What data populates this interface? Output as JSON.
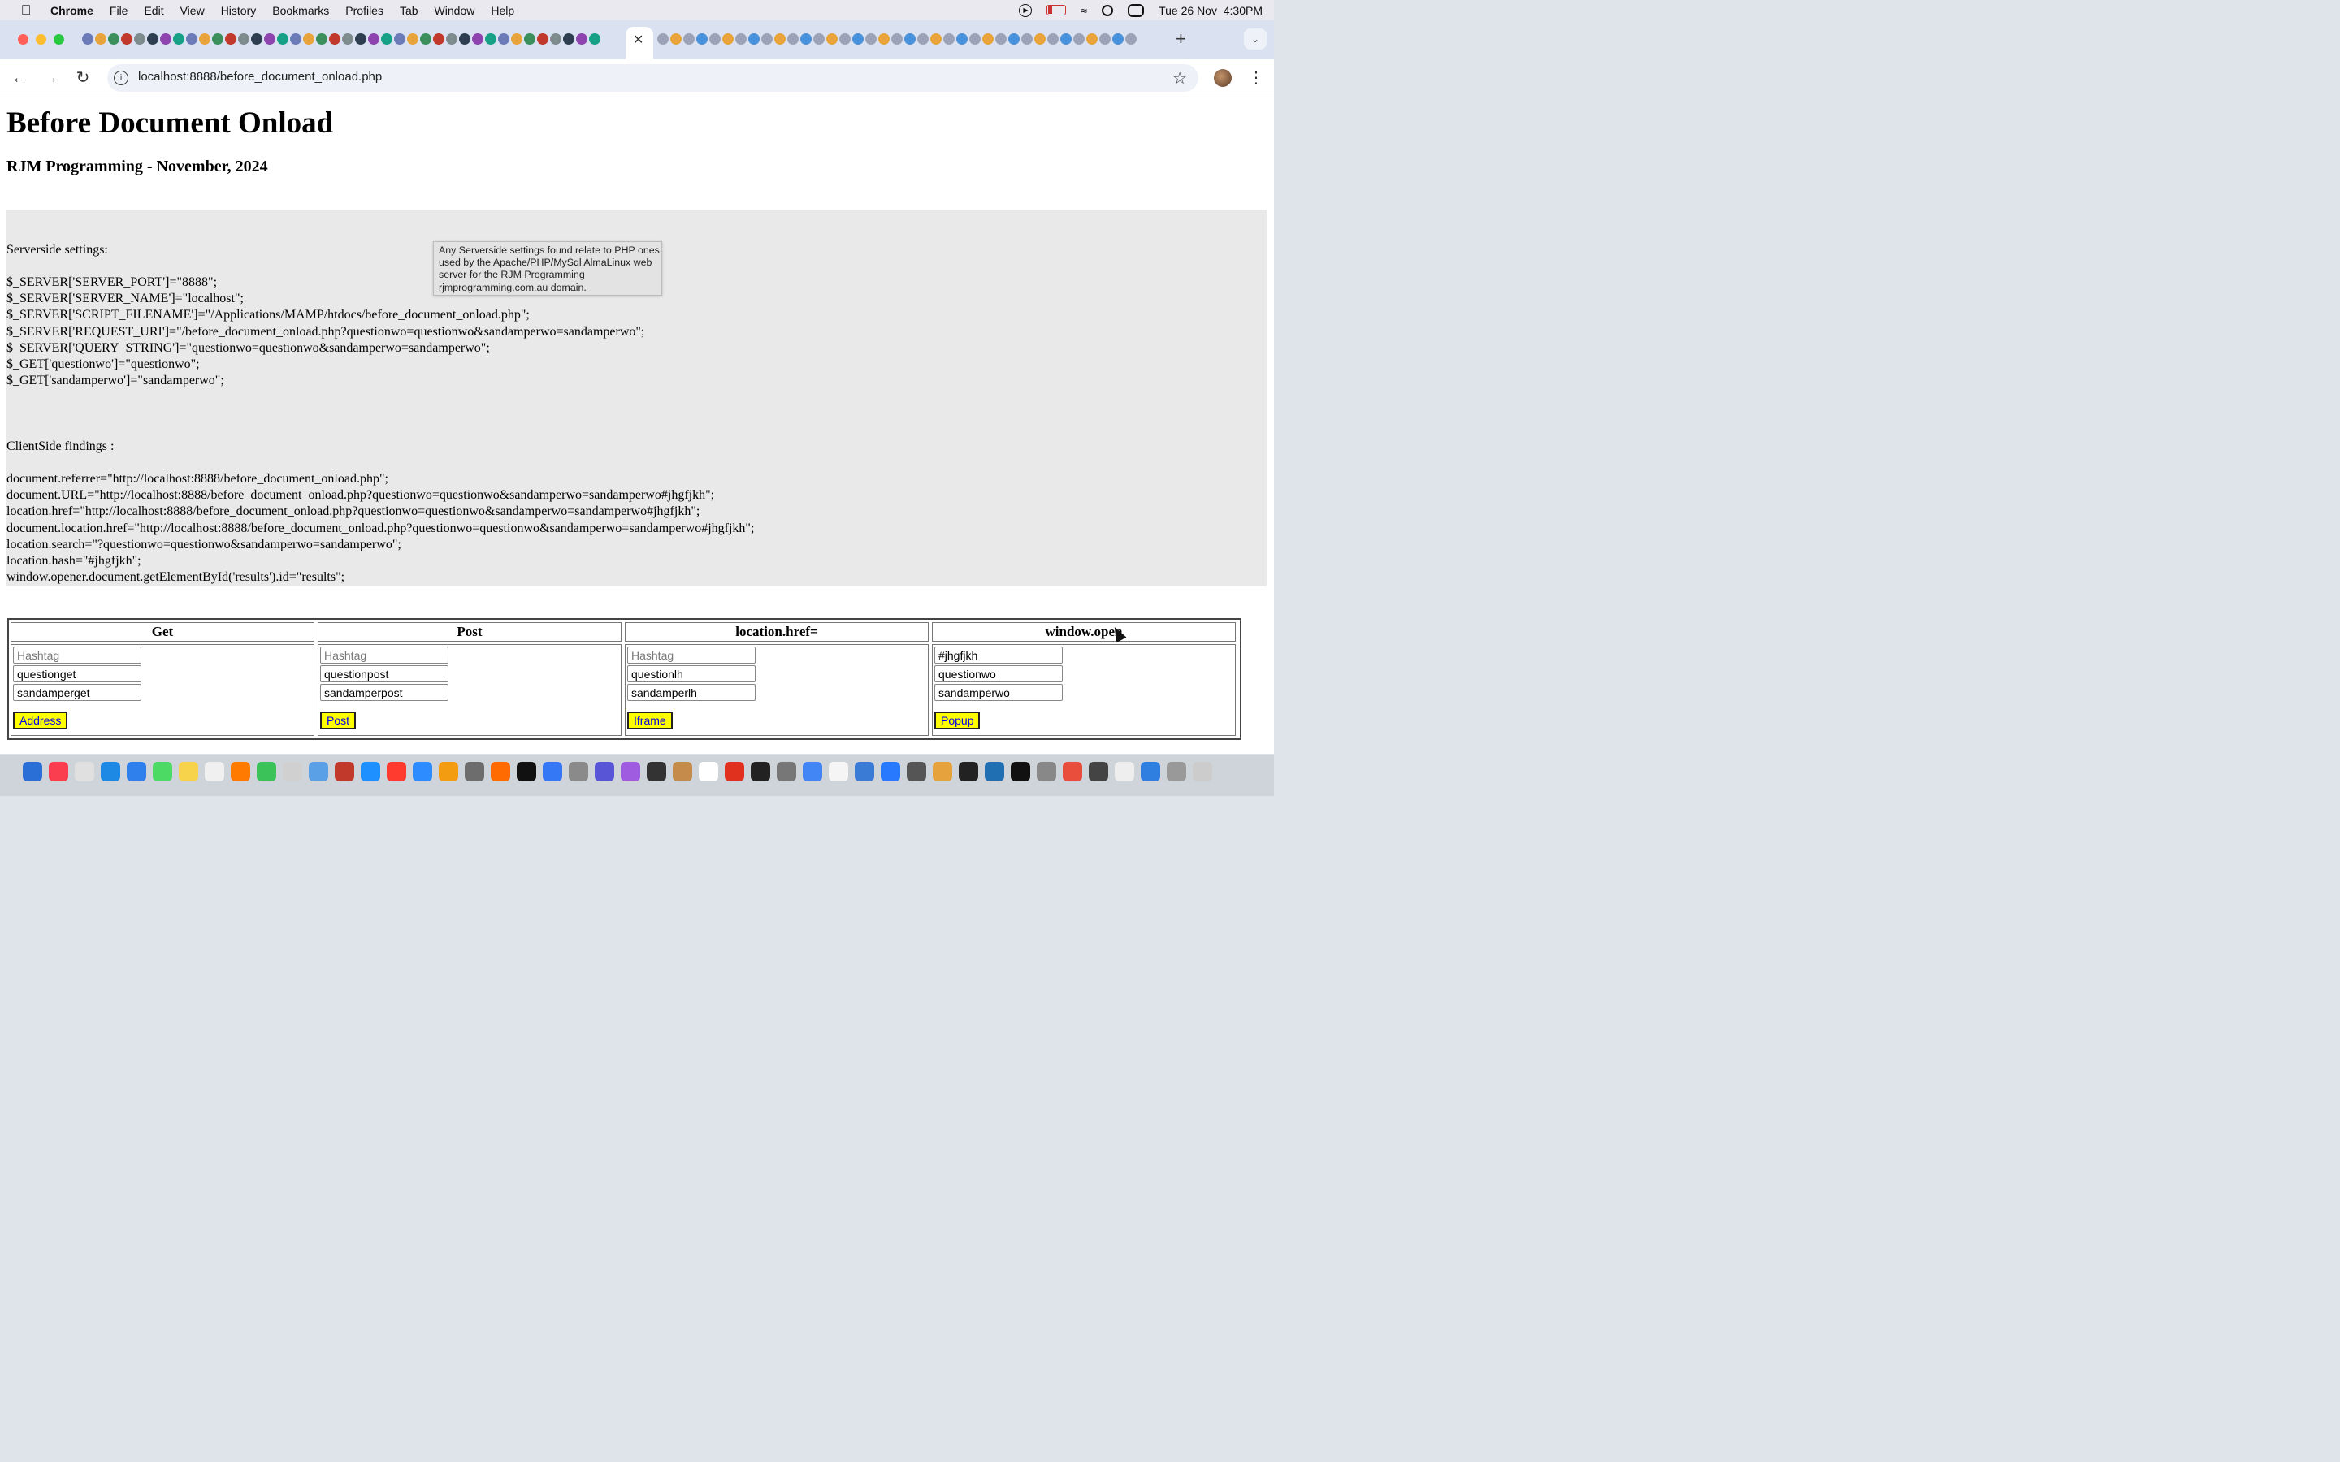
{
  "menubar": {
    "app": "Chrome",
    "items": [
      "File",
      "Edit",
      "View",
      "History",
      "Bookmarks",
      "Profiles",
      "Tab",
      "Window",
      "Help"
    ],
    "datetime": "Tue 26 Nov  4:30PM"
  },
  "toolbar": {
    "url": "localhost:8888/before_document_onload.php"
  },
  "page": {
    "title": "Before Document Onload",
    "subtitle": "RJM Programming - November, 2024",
    "server_heading": "Serverside settings:",
    "server_lines": [
      "$_SERVER['SERVER_PORT']=\"8888\";",
      "$_SERVER['SERVER_NAME']=\"localhost\";",
      "$_SERVER['SCRIPT_FILENAME']=\"/Applications/MAMP/htdocs/before_document_onload.php\";",
      "$_SERVER['REQUEST_URI']=\"/before_document_onload.php?questionwo=questionwo&sandamperwo=sandamperwo\";",
      "$_SERVER['QUERY_STRING']=\"questionwo=questionwo&sandamperwo=sandamperwo\";",
      "$_GET['questionwo']=\"questionwo\";",
      "$_GET['sandamperwo']=\"sandamperwo\";"
    ],
    "client_heading": "ClientSide findings :",
    "client_lines": [
      "document.referrer=\"http://localhost:8888/before_document_onload.php\";",
      "document.URL=\"http://localhost:8888/before_document_onload.php?questionwo=questionwo&sandamperwo=sandamperwo#jhgfjkh\";",
      "location.href=\"http://localhost:8888/before_document_onload.php?questionwo=questionwo&sandamperwo=sandamperwo#jhgfjkh\";",
      "document.location.href=\"http://localhost:8888/before_document_onload.php?questionwo=questionwo&sandamperwo=sandamperwo#jhgfjkh\";",
      "location.search=\"?questionwo=questionwo&sandamperwo=sandamperwo\";",
      "location.hash=\"#jhgfjkh\";",
      "window.opener.document.getElementById('results').id=\"results\";"
    ],
    "tooltip": "Any Serverside settings found relate to PHP ones used by the Apache/PHP/MySql AlmaLinux web server for the RJM Programming rjmprogramming.com.au domain."
  },
  "forms": [
    {
      "header": "Get",
      "hashtag_placeholder": "Hashtag",
      "hashtag_value": "",
      "question": "questionget",
      "sandamper": "sandamperget",
      "button": "Address"
    },
    {
      "header": "Post",
      "hashtag_placeholder": "Hashtag",
      "hashtag_value": "",
      "question": "questionpost",
      "sandamper": "sandamperpost",
      "button": "Post"
    },
    {
      "header": "location.href=",
      "hashtag_placeholder": "Hashtag",
      "hashtag_value": "",
      "question": "questionlh",
      "sandamper": "sandamperlh",
      "button": "Iframe"
    },
    {
      "header": "window.open",
      "hashtag_placeholder": "Hashtag",
      "hashtag_value": "#jhgfjkh",
      "question": "questionwo",
      "sandamper": "sandamperwo",
      "button": "Popup"
    }
  ],
  "colors": {
    "button_bg": "#ffff00",
    "button_text": "#0000ee",
    "results_bg": "#e9e9e9",
    "tabstrip_bg": "#dae2f1"
  },
  "icons": {
    "apple": "apple-icon",
    "back": "back-arrow-icon",
    "forward": "forward-arrow-icon",
    "reload": "reload-icon",
    "info": "site-info-icon",
    "bookmark": "star-icon",
    "menu": "kebab-menu-icon",
    "close_tab": "close-icon",
    "new_tab": "plus-icon"
  }
}
